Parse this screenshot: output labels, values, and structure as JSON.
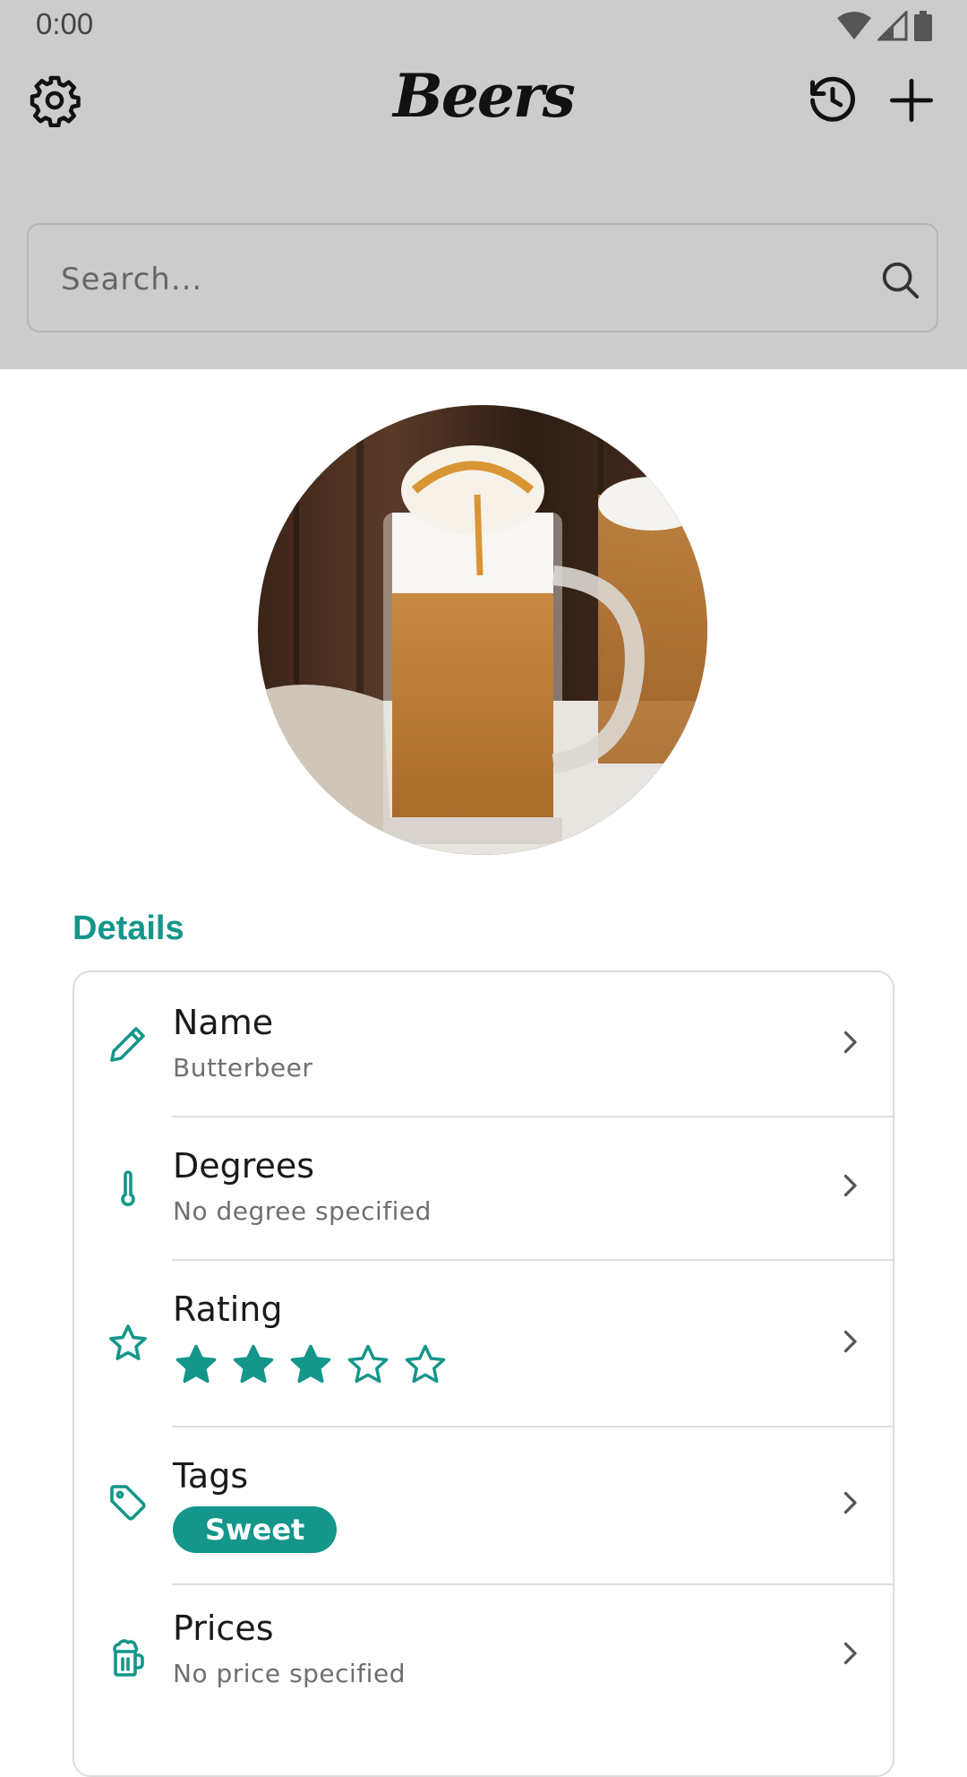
{
  "status_bar": {
    "time": "0:00"
  },
  "header": {
    "title": "Beers"
  },
  "search": {
    "placeholder": "Search..."
  },
  "photo": {
    "alt": "Butterbeer"
  },
  "details": {
    "section_title": "Details",
    "name": {
      "label": "Name",
      "value": "Butterbeer"
    },
    "degrees": {
      "label": "Degrees",
      "value": "No degree specified"
    },
    "rating": {
      "label": "Rating",
      "value": 3,
      "max": 5
    },
    "tags": {
      "label": "Tags",
      "items": [
        "Sweet"
      ]
    },
    "prices": {
      "label": "Prices",
      "value": "No price specified"
    }
  },
  "colors": {
    "accent": "#14968a",
    "header_bg": "#cccccc"
  },
  "icons": [
    "gear-icon",
    "history-icon",
    "plus-icon",
    "search-icon",
    "pencil-icon",
    "thermometer-icon",
    "star-icon",
    "tag-icon",
    "beer-mug-icon",
    "chevron-right-icon"
  ]
}
